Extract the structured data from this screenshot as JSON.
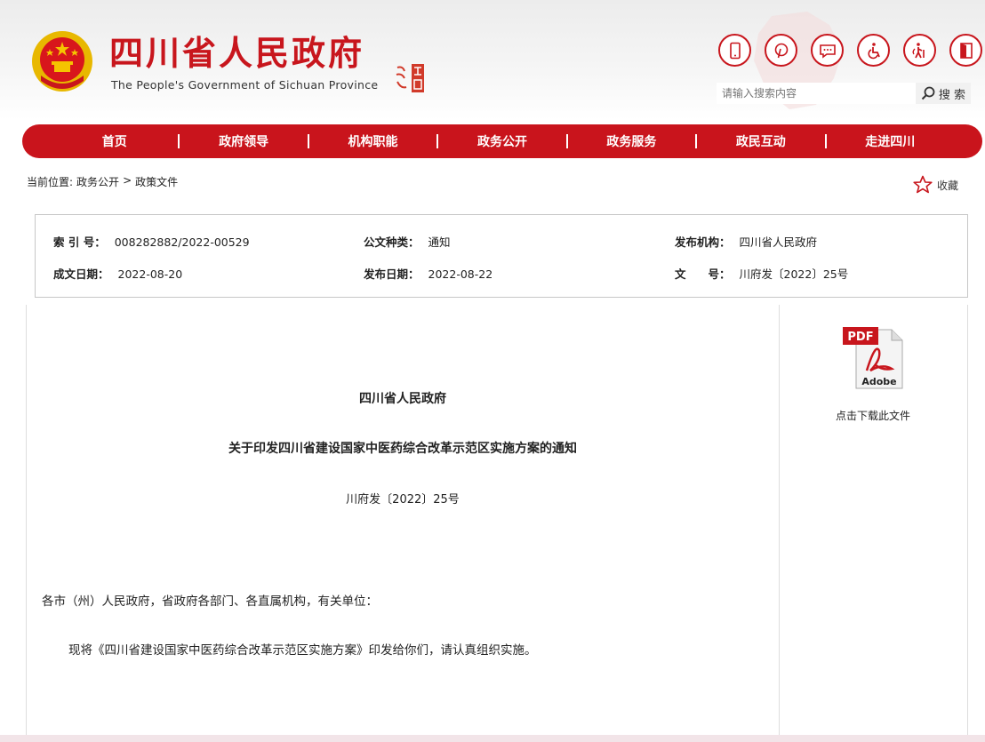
{
  "header": {
    "title": "四川省人民政府",
    "subtitle": "The People's Government of Sichuan Province",
    "top_icons": [
      "mobile-icon",
      "pinterest-icon",
      "message-icon",
      "accessibility-icon",
      "elderly-care-icon",
      "exit-icon"
    ],
    "search_placeholder": "请输入搜索内容",
    "search_button": "搜 索"
  },
  "nav": {
    "items": [
      "首页",
      "政府领导",
      "机构职能",
      "政务公开",
      "政务服务",
      "政民互动",
      "走进四川"
    ]
  },
  "breadcrumb": {
    "prefix": "当前位置:",
    "items": [
      "政务公开",
      "政策文件"
    ],
    "separator": ">"
  },
  "favorite_label": "收藏",
  "info": {
    "index_label": "索 引 号：",
    "index_value": "008282882/2022-00529",
    "type_label": "公文种类：",
    "type_value": "通知",
    "publisher_label": "发布机构：",
    "publisher_value": "四川省人民政府",
    "created_label": "成文日期：",
    "created_value": "2022-08-20",
    "published_label": "发布日期：",
    "published_value": "2022-08-22",
    "docno_label": "文　　号：",
    "docno_value": "川府发〔2022〕25号"
  },
  "document": {
    "org": "四川省人民政府",
    "title": "关于印发四川省建设国家中医药综合改革示范区实施方案的通知",
    "number": "川府发〔2022〕25号",
    "salutation": "各市（州）人民政府，省政府各部门、各直属机构，有关单位：",
    "body": "现将《四川省建设国家中医药综合改革示范区实施方案》印发给你们，请认真组织实施。"
  },
  "download": {
    "label": "点击下载此文件",
    "pdf_text": "PDF",
    "brand_text": "Adobe"
  },
  "colors": {
    "brand_red": "#c9141c",
    "gold": "#f5c400"
  }
}
